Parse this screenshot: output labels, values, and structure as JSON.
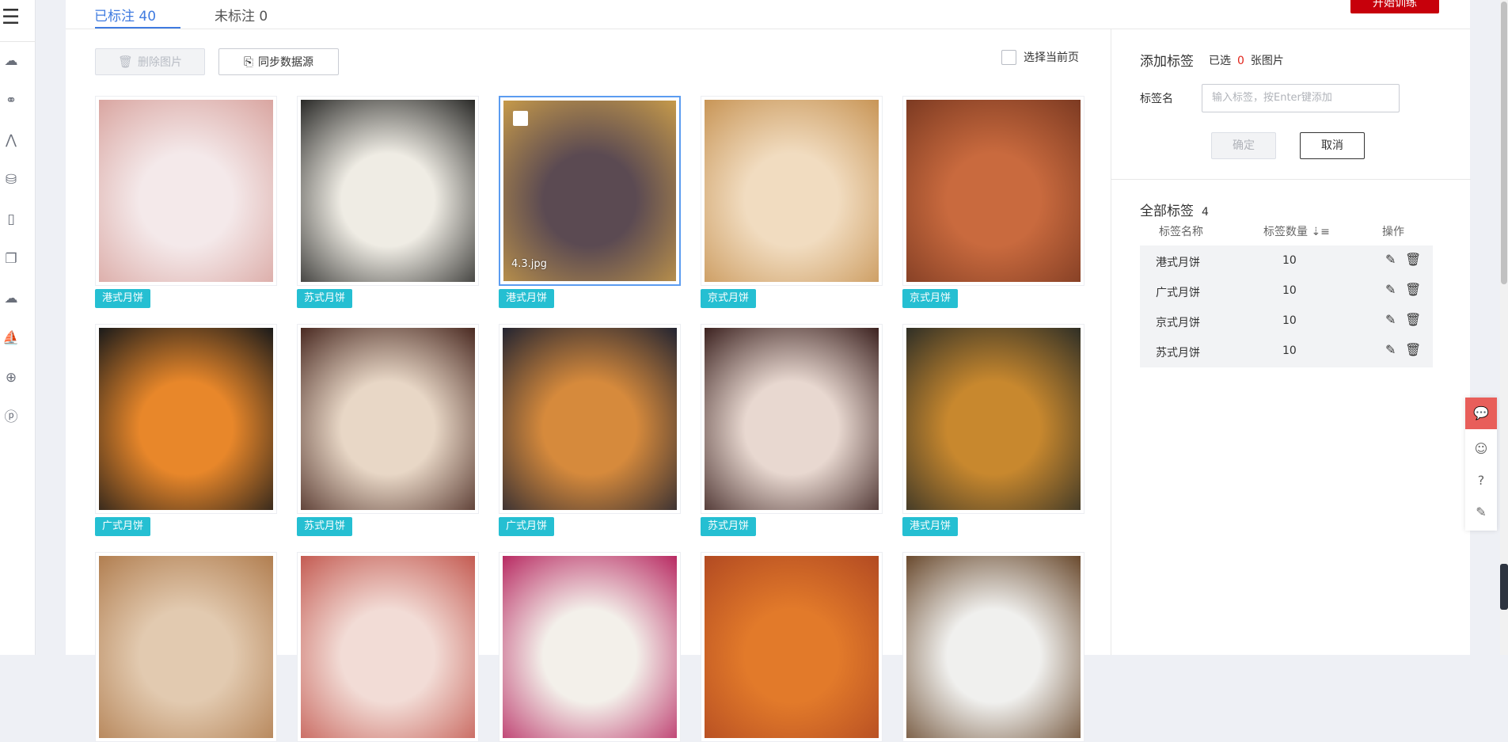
{
  "tabs": {
    "labeled": "已标注 40",
    "unlabeled": "未标注 0"
  },
  "train_button": "开始训练",
  "toolbar": {
    "delete": "删除图片",
    "sync": "同步数据源",
    "select_page": "选择当前页"
  },
  "grid": {
    "items": [
      {
        "tag": "港式月饼",
        "colors": [
          "#f4e9ea",
          "#d9a5a0"
        ]
      },
      {
        "tag": "苏式月饼",
        "colors": [
          "#efece4",
          "#2a2a28"
        ]
      },
      {
        "tag": "港式月饼",
        "colors": [
          "#5b4a52",
          "#c69a4a"
        ],
        "filename": "4.3.jpg",
        "selected": true
      },
      {
        "tag": "京式月饼",
        "colors": [
          "#f1dcc0",
          "#c89556"
        ]
      },
      {
        "tag": "京式月饼",
        "colors": [
          "#c96a3e",
          "#7c3a22"
        ]
      },
      {
        "tag": "广式月饼",
        "colors": [
          "#e8872a",
          "#1a1a1a"
        ]
      },
      {
        "tag": "苏式月饼",
        "colors": [
          "#e8d7c6",
          "#4a2a22"
        ]
      },
      {
        "tag": "广式月饼",
        "colors": [
          "#d68a3c",
          "#232431"
        ]
      },
      {
        "tag": "苏式月饼",
        "colors": [
          "#e8d8d0",
          "#3c2220"
        ]
      },
      {
        "tag": "港式月饼",
        "colors": [
          "#c8882e",
          "#2f2f26"
        ]
      },
      {
        "tag": "",
        "colors": [
          "#e2cab0",
          "#b17e50"
        ]
      },
      {
        "tag": "",
        "colors": [
          "#f2dcd6",
          "#c45b52"
        ]
      },
      {
        "tag": "",
        "colors": [
          "#f3f0ea",
          "#b82a62"
        ]
      },
      {
        "tag": "",
        "colors": [
          "#e27a2a",
          "#b24a22"
        ]
      },
      {
        "tag": "",
        "colors": [
          "#f0f0ee",
          "#6a4a2e"
        ]
      }
    ]
  },
  "right_panel": {
    "add_title": "添加标签",
    "selected_prefix": "已选",
    "selected_count": "0",
    "selected_suffix": "张图片",
    "label_name": "标签名",
    "input_placeholder": "输入标签，按Enter键添加",
    "confirm": "确定",
    "cancel": "取消",
    "all_title": "全部标签",
    "all_count": "4",
    "col_name": "标签名称",
    "col_count": "标签数量",
    "col_ops": "操作",
    "rows": [
      {
        "name": "港式月饼",
        "count": "10"
      },
      {
        "name": "广式月饼",
        "count": "10"
      },
      {
        "name": "京式月饼",
        "count": "10"
      },
      {
        "name": "苏式月饼",
        "count": "10"
      }
    ]
  },
  "icons": [
    "menu-icon",
    "cloud-icon",
    "cluster-icon",
    "network-icon",
    "database-icon",
    "device-icon",
    "copy-icon",
    "cloud-check-icon",
    "sail-icon",
    "globe-icon",
    "ip-icon",
    "chat-icon",
    "smile-icon",
    "help-icon",
    "note-icon"
  ]
}
